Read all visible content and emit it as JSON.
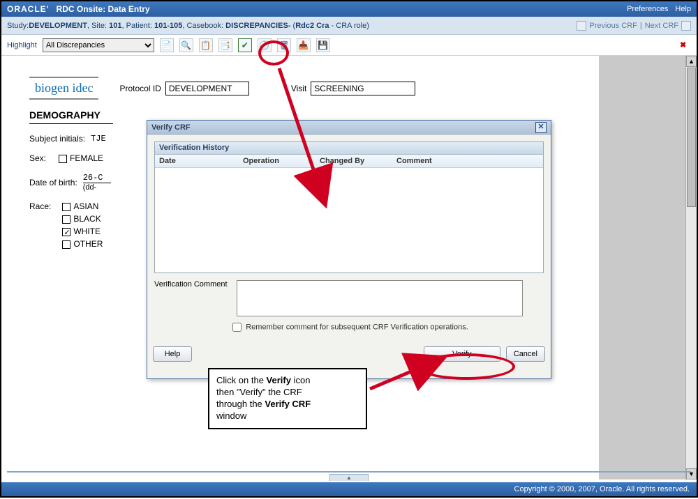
{
  "titlebar": {
    "brand": "ORACLE'",
    "title": "RDC Onsite: Data Entry",
    "links": {
      "preferences": "Preferences",
      "help": "Help"
    }
  },
  "context": {
    "study_label": "Study:",
    "study_value": "DEVELOPMENT",
    "site_label": "Site:",
    "site_value": "101",
    "patient_label": "Patient:",
    "patient_value": "101-105",
    "casebook_label": "Casebook:",
    "casebook_value": "DISCREPANCIES-",
    "user": "Rdc2 Cra",
    "role": "CRA role",
    "prev_crf": "Previous CRF",
    "next_crf": "Next CRF"
  },
  "toolbar": {
    "highlight_label": "Highlight",
    "highlight_value": "All Discrepancies"
  },
  "form": {
    "logo": "biogen idec",
    "protocol_label": "Protocol ID",
    "protocol_value": "DEVELOPMENT",
    "visit_label": "Visit",
    "visit_value": "SCREENING",
    "section": "DEMOGRAPHY",
    "subject_label": "Subject initials:",
    "subject_value": "TJE",
    "sex_label": "Sex:",
    "sex_option": "FEMALE",
    "dob_label": "Date of birth:",
    "dob_value": "26-C",
    "dob_hint": "(dd-",
    "race_label": "Race:",
    "races": [
      "ASIAN",
      "BLACK",
      "WHITE",
      "OTHER"
    ]
  },
  "dialog": {
    "title": "Verify CRF",
    "history_title": "Verification History",
    "cols": {
      "date": "Date",
      "operation": "Operation",
      "changed_by": "Changed By",
      "comment": "Comment"
    },
    "vc_label": "Verification Comment",
    "remember": "Remember comment for subsequent CRF Verification operations.",
    "help": "Help",
    "verify": "Verify",
    "cancel": "Cancel"
  },
  "annotation": {
    "l1a": "Click on the ",
    "l1b": "Verify",
    "l1c": " icon",
    "l2": "then \"Verify\" the CRF",
    "l3a": "through the ",
    "l3b": "Verify CRF",
    "l4": "window"
  },
  "footer": {
    "copyright": "Copyright © 2000, 2007, Oracle. All rights reserved."
  }
}
